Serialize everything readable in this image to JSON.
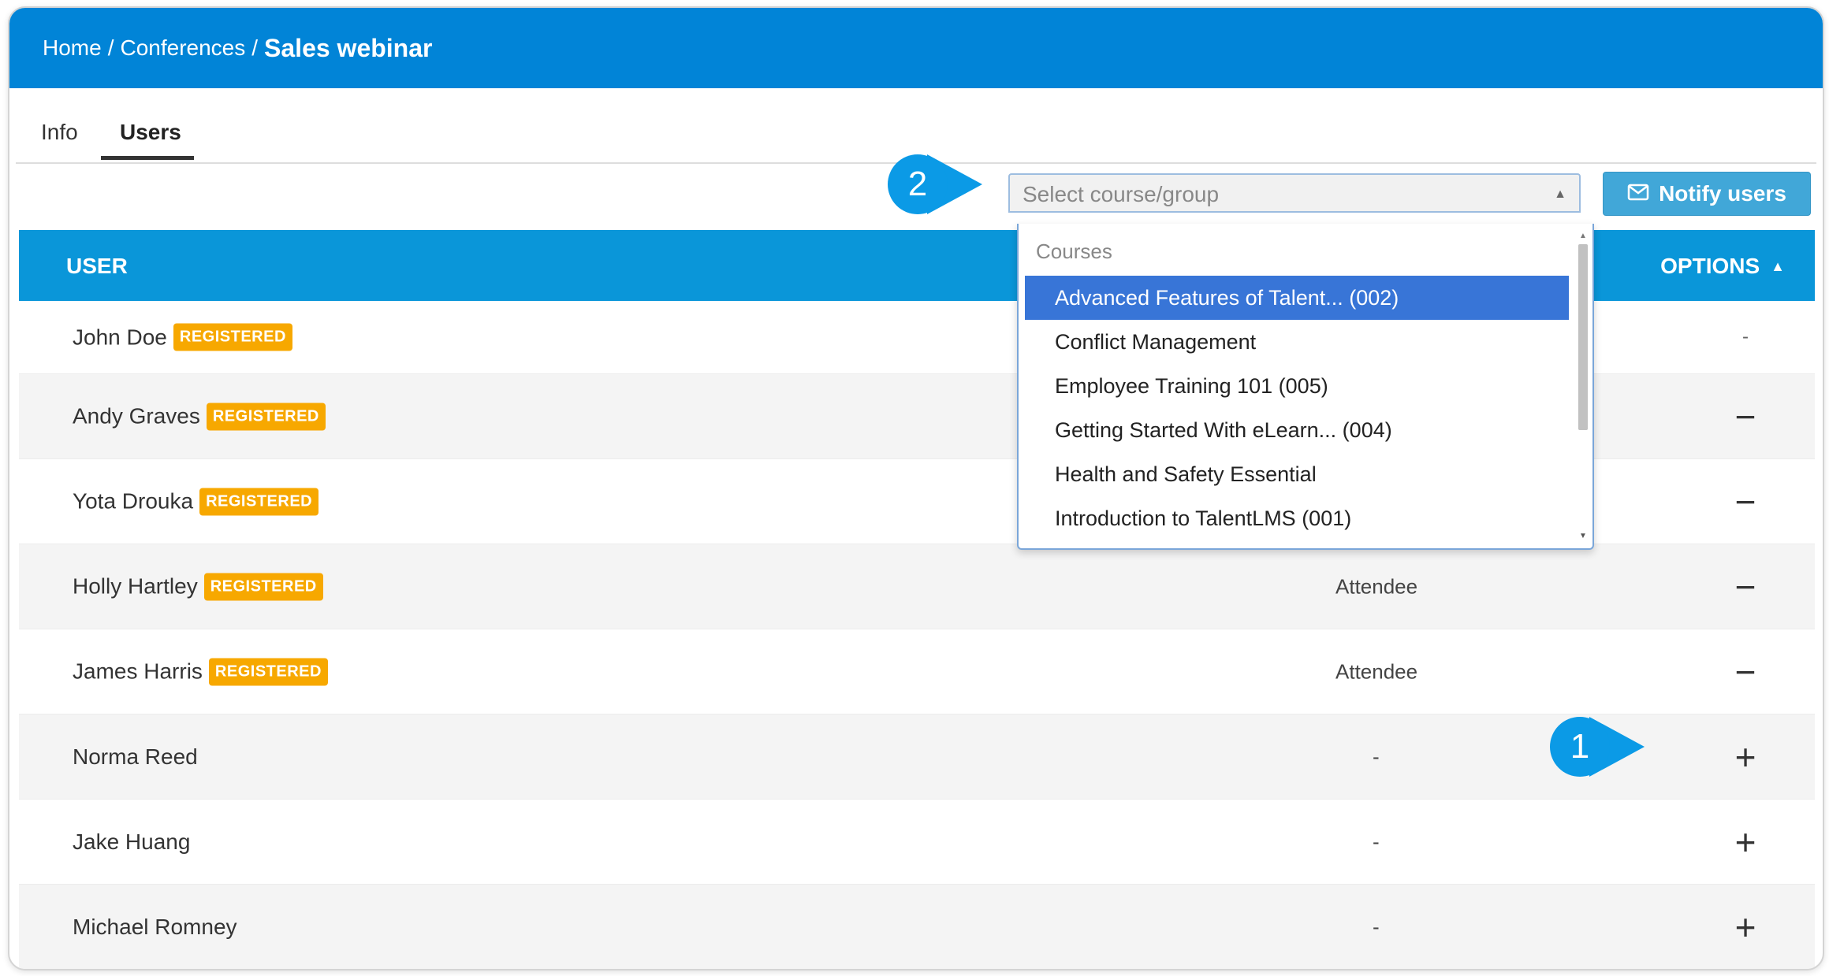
{
  "breadcrumb": {
    "home": "Home",
    "separator": "/",
    "conferences": "Conferences",
    "current": "Sales webinar"
  },
  "tabs": [
    {
      "label": "Info",
      "active": false
    },
    {
      "label": "Users",
      "active": true
    }
  ],
  "filter": {
    "placeholder": "Select course/group",
    "notify_label": "Notify users"
  },
  "callouts": {
    "one": "1",
    "two": "2"
  },
  "table": {
    "col_user": "USER",
    "col_options": "OPTIONS",
    "rows": [
      {
        "name": "John Doe",
        "badge": "REGISTERED",
        "role": "",
        "option": "-"
      },
      {
        "name": "Andy Graves",
        "badge": "REGISTERED",
        "role": "",
        "option": "−"
      },
      {
        "name": "Yota Drouka",
        "badge": "REGISTERED",
        "role": "",
        "option": "−"
      },
      {
        "name": "Holly Hartley",
        "badge": "REGISTERED",
        "role": "Attendee",
        "option": "−"
      },
      {
        "name": "James Harris",
        "badge": "REGISTERED",
        "role": "Attendee",
        "option": "−"
      },
      {
        "name": "Norma Reed",
        "badge": "",
        "role": "-",
        "option": "+"
      },
      {
        "name": "Jake Huang",
        "badge": "",
        "role": "-",
        "option": "+"
      },
      {
        "name": "Michael Romney",
        "badge": "",
        "role": "-",
        "option": "+"
      }
    ]
  },
  "dropdown": {
    "group_label": "Courses",
    "items": [
      {
        "label": "Advanced Features of Talent... (002)",
        "highlighted": true
      },
      {
        "label": "Conflict Management",
        "highlighted": false
      },
      {
        "label": "Employee Training 101 (005)",
        "highlighted": false
      },
      {
        "label": "Getting Started With eLearn... (004)",
        "highlighted": false
      },
      {
        "label": "Health and Safety Essential",
        "highlighted": false
      },
      {
        "label": "Introduction to TalentLMS (001)",
        "highlighted": false
      }
    ]
  },
  "colors": {
    "header_blue": "#0184d7",
    "table_header_blue": "#0a96d9",
    "badge_orange": "#f7a800",
    "highlight_blue": "#3875d7",
    "callout_blue": "#0b9ae6"
  }
}
